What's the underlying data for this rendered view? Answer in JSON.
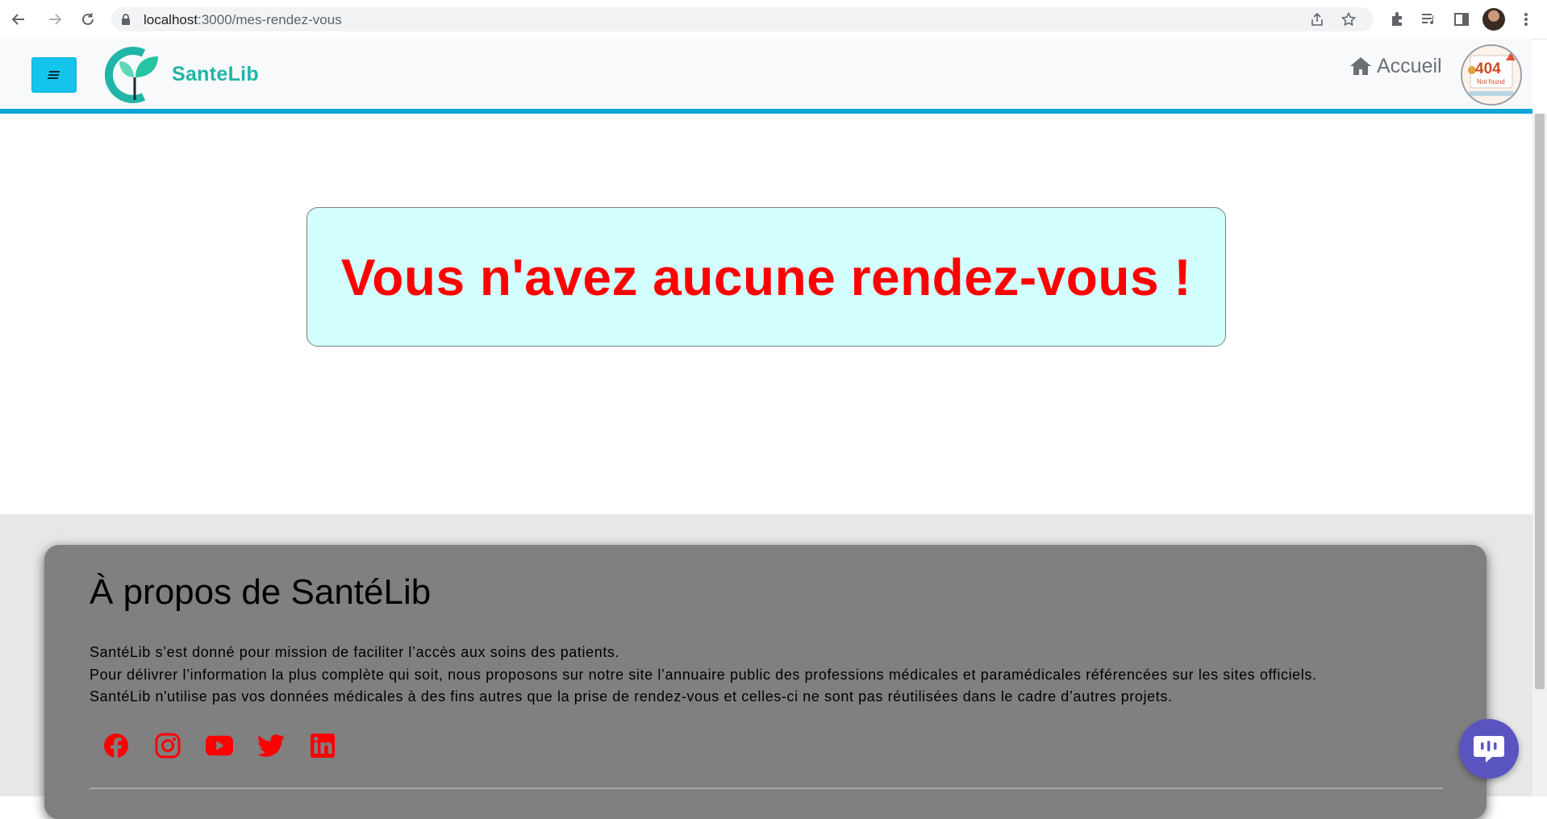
{
  "browser": {
    "url_host": "localhost",
    "url_path": ":3000/mes-rendez-vous"
  },
  "header": {
    "brand": "SanteLib",
    "home_label": "Accueil",
    "avatar_badge": "404",
    "avatar_sub": "Not found"
  },
  "main": {
    "empty_message": "Vous n'avez aucune rendez-vous !"
  },
  "footer": {
    "about_title": "À propos de SantéLib",
    "about_lines": [
      "SantéLib s’est donné pour mission de faciliter l’accès aux soins des patients.",
      "Pour délivrer l’information la plus complète qui soit, nous proposons sur notre site l’annuaire public des professions médicales et paramédicales référencées sur les sites officiels.",
      "SantéLib n'utilise pas vos données médicales à des fins autres que la prise de rendez-vous et celles-ci ne sont pas réutilisées dans le cadre d’autres projets."
    ],
    "socials": [
      "facebook-icon",
      "instagram-icon",
      "youtube-icon",
      "twitter-icon",
      "linkedin-icon"
    ]
  },
  "colors": {
    "accent": "#14c4ec",
    "header_border": "#0ea5d8",
    "brand_teal": "#1fb5a8",
    "message_red": "#ff0000",
    "box_bg": "#d2fefd",
    "footer_card": "#808080",
    "social_red": "#ff0000",
    "chat_purple": "#5a54c0"
  }
}
